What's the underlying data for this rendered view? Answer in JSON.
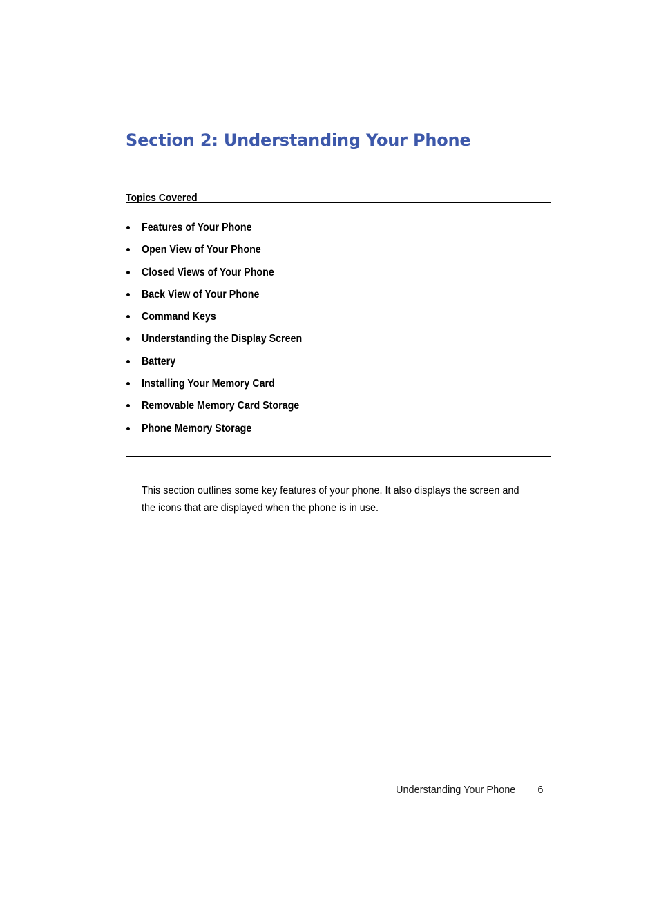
{
  "document": {
    "section_title": "Section 2: Understanding Your Phone",
    "topics_heading": "Topics Covered",
    "topics": [
      {
        "label": "Features of Your Phone"
      },
      {
        "label": "Open View of Your Phone"
      },
      {
        "label": "Closed Views of Your Phone"
      },
      {
        "label": "Back View of Your Phone"
      },
      {
        "label": "Command Keys"
      },
      {
        "label": "Understanding the Display Screen"
      },
      {
        "label": "Battery"
      },
      {
        "label": "Installing Your Memory Card"
      },
      {
        "label": "Removable Memory Card Storage"
      },
      {
        "label": "Phone Memory Storage"
      }
    ],
    "intro_paragraph": "This section outlines some key features of your phone. It also displays the screen and the icons that are displayed when the phone is in use.",
    "footer": {
      "running_title": "Understanding Your Phone",
      "page_number": "6"
    },
    "colors": {
      "title_blue": "#3d58aa",
      "body_text": "#000000",
      "rule": "#000000",
      "page_background": "#ffffff"
    }
  }
}
